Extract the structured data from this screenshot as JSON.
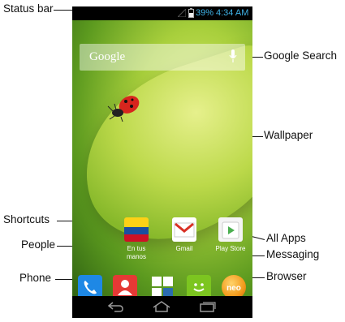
{
  "callouts": {
    "status_bar": "Status bar",
    "google_search": "Google Search",
    "wallpaper": "Wallpaper",
    "shortcuts": "Shortcuts",
    "people": "People",
    "all_apps": "All Apps",
    "messaging": "Messaging",
    "phone": "Phone",
    "browser": "Browser"
  },
  "status": {
    "battery": "39%",
    "time": "4:34 AM"
  },
  "search": {
    "label": "Google"
  },
  "shortcuts": [
    {
      "label_line1": "En tus",
      "label_line2": "manos"
    },
    {
      "label_line1": "Gmail",
      "label_line2": ""
    },
    {
      "label_line1": "Play Store",
      "label_line2": ""
    }
  ],
  "colors": {
    "status_text": "#3fb2e6",
    "phone_icon": "#1e88e5",
    "people_icon": "#e53935",
    "messaging_icon": "#7cc520",
    "browser_icon": "#f39a1b"
  }
}
